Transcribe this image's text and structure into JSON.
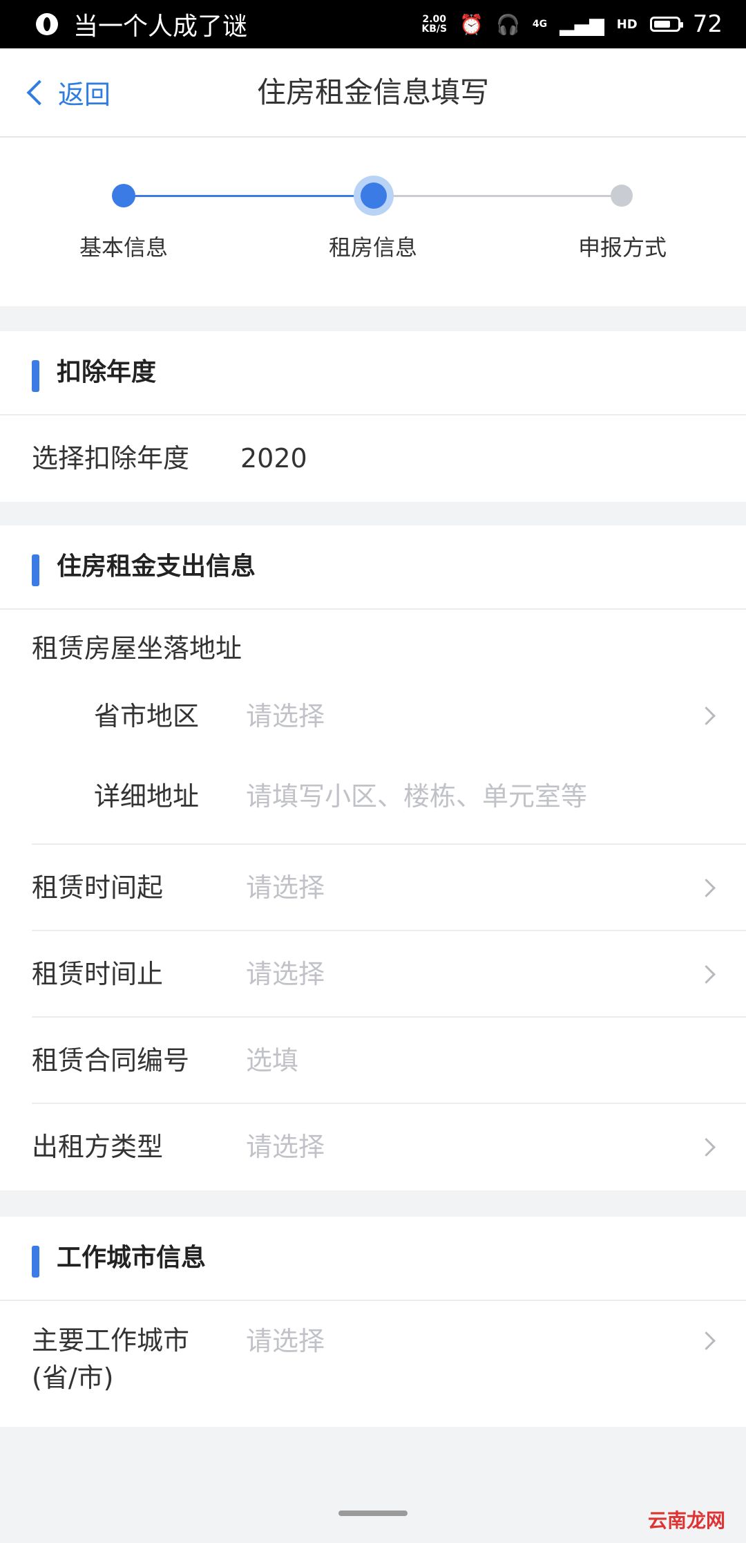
{
  "status_bar": {
    "notification": "当一个人成了谜",
    "speed_top": "2.00",
    "speed_unit": "KB/S",
    "network": "4G",
    "hd": "HD",
    "battery": "72"
  },
  "header": {
    "back_label": "返回",
    "title": "住房租金信息填写"
  },
  "stepper": {
    "steps": [
      {
        "label": "基本信息",
        "state": "done"
      },
      {
        "label": "租房信息",
        "state": "current"
      },
      {
        "label": "申报方式",
        "state": "todo"
      }
    ]
  },
  "year_section": {
    "title": "扣除年度",
    "label": "选择扣除年度",
    "value": "2020"
  },
  "rent_section": {
    "title": "住房租金支出信息",
    "address_label": "租赁房屋坐落地址",
    "region_label": "省市地区",
    "region_placeholder": "请选择",
    "detail_label": "详细地址",
    "detail_placeholder": "请填写小区、楼栋、单元室等",
    "start_label": "租赁时间起",
    "start_placeholder": "请选择",
    "end_label": "租赁时间止",
    "end_placeholder": "请选择",
    "contract_label": "租赁合同编号",
    "contract_placeholder": "选填",
    "lessor_label": "出租方类型",
    "lessor_placeholder": "请选择"
  },
  "city_section": {
    "title": "工作城市信息",
    "city_label_line1": "主要工作城市",
    "city_label_line2": "(省/市)",
    "city_placeholder": "请选择"
  },
  "watermark": "云南龙网",
  "colors": {
    "accent": "#3a7be6",
    "placeholder": "#c0c2c7",
    "background": "#f2f3f5"
  }
}
